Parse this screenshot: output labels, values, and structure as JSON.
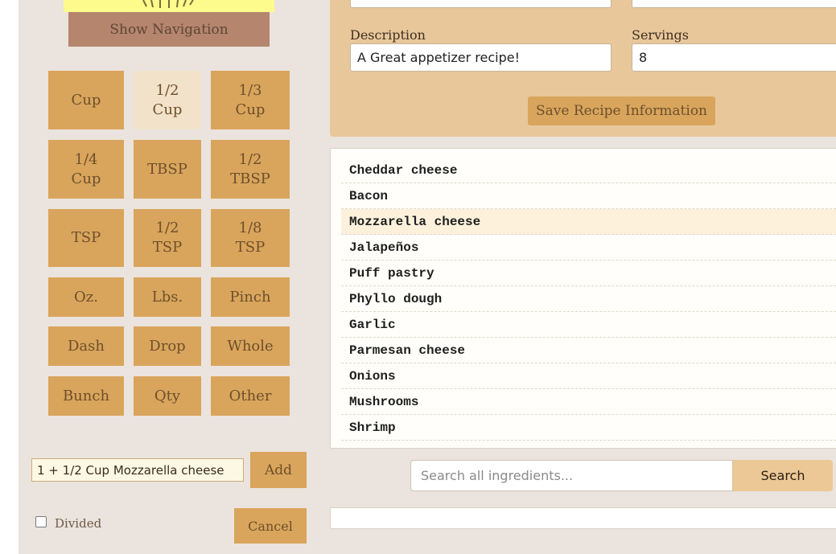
{
  "navigation": {
    "show_label": "Show Navigation"
  },
  "units": [
    {
      "label": "Cup",
      "selected": false
    },
    {
      "label": "1/2\nCup",
      "selected": true
    },
    {
      "label": "1/3\nCup",
      "selected": false
    },
    {
      "label": "1/4\nCup",
      "selected": false
    },
    {
      "label": "TBSP",
      "selected": false
    },
    {
      "label": "1/2\nTBSP",
      "selected": false
    },
    {
      "label": "TSP",
      "selected": false
    },
    {
      "label": "1/2\nTSP",
      "selected": false
    },
    {
      "label": "1/8\nTSP",
      "selected": false
    },
    {
      "label": "Oz.",
      "selected": false
    },
    {
      "label": "Lbs.",
      "selected": false
    },
    {
      "label": "Pinch",
      "selected": false
    },
    {
      "label": "Dash",
      "selected": false
    },
    {
      "label": "Drop",
      "selected": false
    },
    {
      "label": "Whole",
      "selected": false
    },
    {
      "label": "Bunch",
      "selected": false
    },
    {
      "label": "Qty",
      "selected": false
    },
    {
      "label": "Other",
      "selected": false
    }
  ],
  "ingredient_entry": {
    "value": "1 + 1/2 Cup Mozzarella cheese",
    "add_label": "Add",
    "divided_label": "Divided",
    "divided_checked": false,
    "cancel_label": "Cancel"
  },
  "recipe_form": {
    "description_label": "Description",
    "description_value": "A Great appetizer recipe!",
    "servings_label": "Servings",
    "servings_value": "8",
    "save_label": "Save Recipe Information"
  },
  "ingredients": [
    {
      "name": "Cheddar cheese",
      "selected": false
    },
    {
      "name": "Bacon",
      "selected": false
    },
    {
      "name": "Mozzarella cheese",
      "selected": true
    },
    {
      "name": "Jalapeños",
      "selected": false
    },
    {
      "name": "Puff pastry",
      "selected": false
    },
    {
      "name": "Phyllo dough",
      "selected": false
    },
    {
      "name": "Garlic",
      "selected": false
    },
    {
      "name": "Parmesan cheese",
      "selected": false
    },
    {
      "name": "Onions",
      "selected": false
    },
    {
      "name": "Mushrooms",
      "selected": false
    },
    {
      "name": "Shrimp",
      "selected": false
    }
  ],
  "search": {
    "placeholder": "Search all ingredients...",
    "button_label": "Search"
  },
  "colors": {
    "page_bg": "#ebe3dd",
    "unit_button": "#d9a55c",
    "unit_button_selected": "#f2e2ca",
    "form_panel": "#e8c79a",
    "nav_button": "#b5856e",
    "logo_yellow": "#fdfb8c",
    "row_selected": "#fdf1dc"
  }
}
